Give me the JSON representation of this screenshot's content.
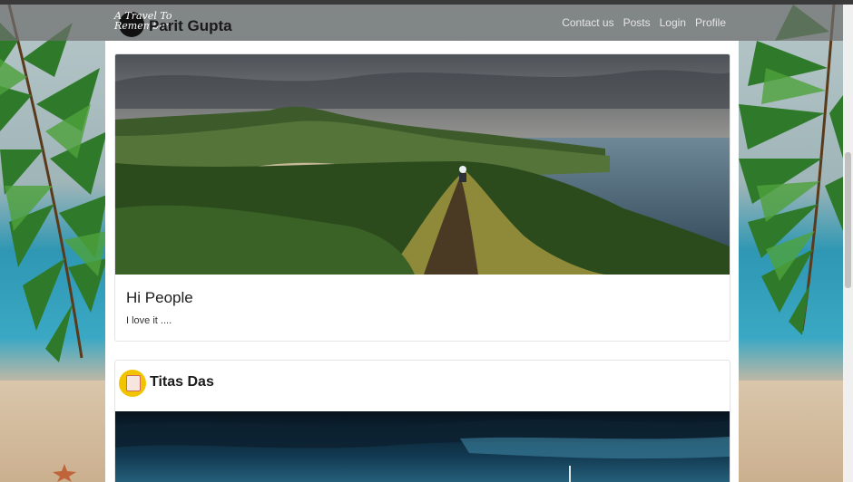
{
  "navbar": {
    "brand_script": "A Travel To Remember",
    "brand_name": "Parit Gupta",
    "links": [
      "Contact us",
      "Posts",
      "Login",
      "Profile"
    ]
  },
  "posts": [
    {
      "author": "Parit Gupta",
      "title": "Hi People",
      "body": "I love it ...."
    },
    {
      "author": "Titas Das"
    }
  ]
}
